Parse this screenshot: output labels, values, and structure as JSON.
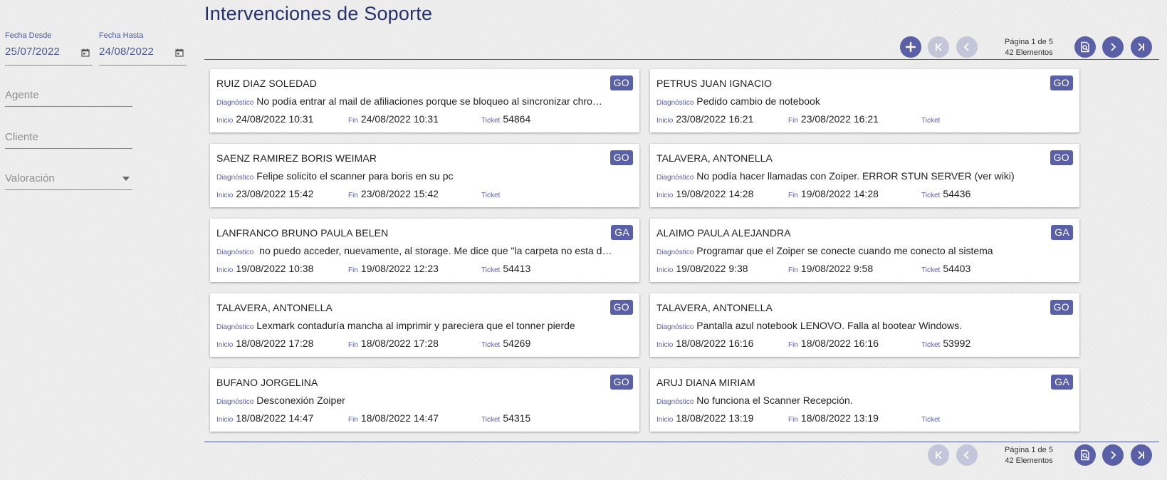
{
  "page": {
    "title": "Intervenciones de Soporte"
  },
  "filters": {
    "fecha_desde": {
      "label": "Fecha Desde",
      "value": "25/07/2022"
    },
    "fecha_hasta": {
      "label": "Fecha Hasta",
      "value": "24/08/2022"
    },
    "agente": {
      "placeholder": "Agente"
    },
    "cliente": {
      "placeholder": "Cliente"
    },
    "valoracion": {
      "placeholder": "Valoración"
    }
  },
  "pagination": {
    "page_text": "Página 1 de 5",
    "count_text": "42 Elementos"
  },
  "labels": {
    "diagnostico": "Diagnóstico",
    "inicio": "Inicio",
    "fin": "Fin",
    "ticket": "Ticket"
  },
  "colors": {
    "accent": "#5a60a8",
    "title": "#27306e",
    "disabled": "#c3c5d8"
  },
  "cards": [
    {
      "name": "RUIZ DIAZ SOLEDAD",
      "badge": "GO",
      "diagnostico": "No podía entrar al mail de afiliaciones porque se bloqueo al sincronizar chro…",
      "inicio": "24/08/2022 10:31",
      "fin": "24/08/2022 10:31",
      "ticket": "54864"
    },
    {
      "name": "PETRUS JUAN IGNACIO",
      "badge": "GO",
      "diagnostico": "Pedido cambio de notebook",
      "inicio": "23/08/2022 16:21",
      "fin": "23/08/2022 16:21",
      "ticket": ""
    },
    {
      "name": "SAENZ RAMIREZ BORIS WEIMAR",
      "badge": "GO",
      "diagnostico": "Felipe solicito el scanner para boris en su pc",
      "inicio": "23/08/2022 15:42",
      "fin": "23/08/2022 15:42",
      "ticket": ""
    },
    {
      "name": "TALAVERA, ANTONELLA",
      "badge": "GO",
      "diagnostico": "No podía hacer llamadas con Zoiper. ERROR STUN SERVER (ver wiki)",
      "inicio": "19/08/2022 14:28",
      "fin": "19/08/2022 14:28",
      "ticket": "54436"
    },
    {
      "name": "LANFRANCO BRUNO PAULA BELEN",
      "badge": "GA",
      "diagnostico": " no puedo acceder, nuevamente, al storage. Me dice que \"la carpeta no esta d…",
      "inicio": "19/08/2022 10:38",
      "fin": "19/08/2022 12:23",
      "ticket": "54413"
    },
    {
      "name": "ALAIMO PAULA ALEJANDRA",
      "badge": "GA",
      "diagnostico": "Programar que el Zoiper se conecte cuando me conecto al sistema",
      "inicio": "19/08/2022 9:38",
      "fin": "19/08/2022 9:58",
      "ticket": "54403"
    },
    {
      "name": "TALAVERA, ANTONELLA",
      "badge": "GO",
      "diagnostico": "Lexmark contaduría mancha al imprimir y pareciera que el tonner pierde",
      "inicio": "18/08/2022 17:28",
      "fin": "18/08/2022 17:28",
      "ticket": "54269"
    },
    {
      "name": "TALAVERA, ANTONELLA",
      "badge": "GO",
      "diagnostico": "Pantalla azul notebook LENOVO. Falla al bootear Windows.",
      "inicio": "18/08/2022 16:16",
      "fin": "18/08/2022 16:16",
      "ticket": "53992"
    },
    {
      "name": "BUFANO JORGELINA",
      "badge": "GO",
      "diagnostico": "Desconexión Zoiper",
      "inicio": "18/08/2022 14:47",
      "fin": "18/08/2022 14:47",
      "ticket": "54315"
    },
    {
      "name": "ARUJ DIANA MIRIAM",
      "badge": "GA",
      "diagnostico": "No funciona el Scanner Recepción.",
      "inicio": "18/08/2022 13:19",
      "fin": "18/08/2022 13:19",
      "ticket": ""
    }
  ]
}
